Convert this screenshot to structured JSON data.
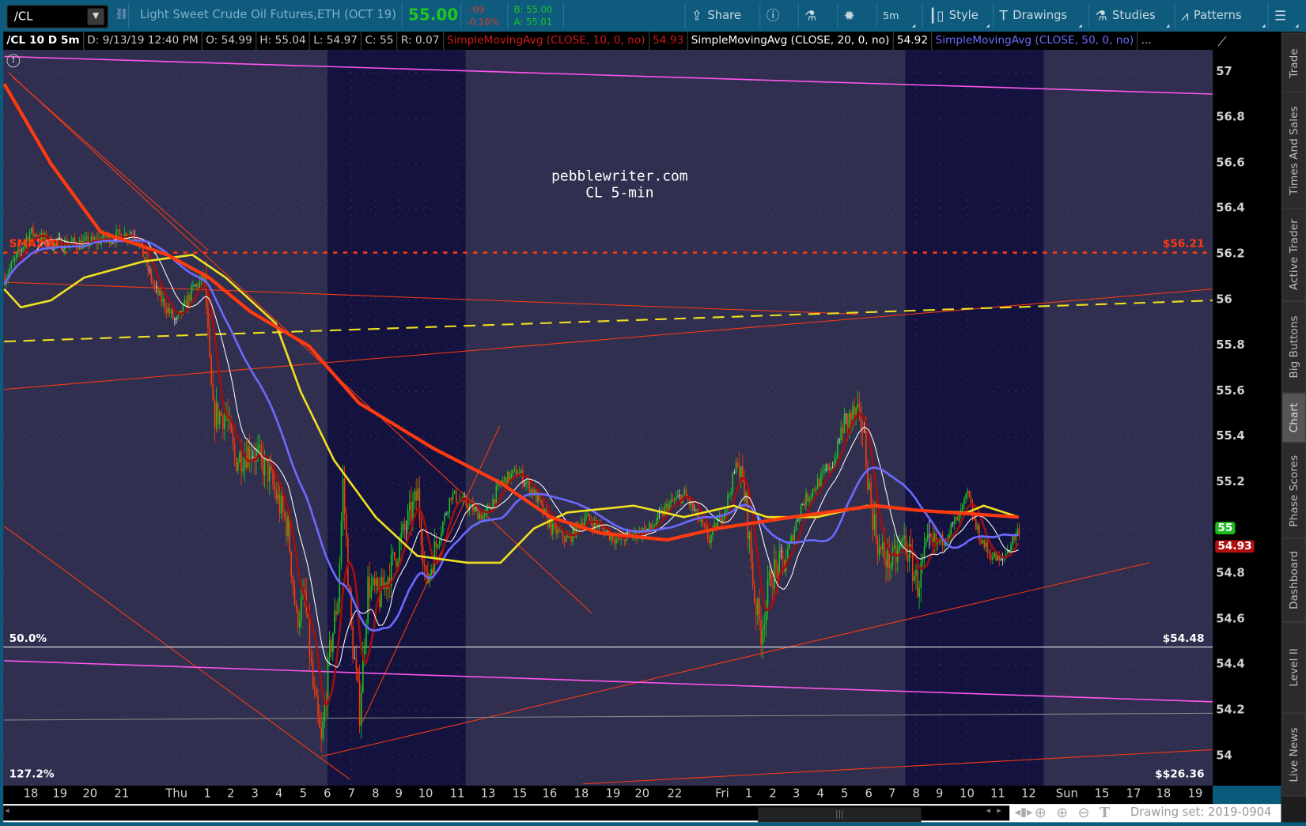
{
  "toolbar": {
    "symbol": "/CL",
    "description": "Light Sweet Crude Oil Futures,ETH (OCT 19)",
    "last": "55.00",
    "net_change": "-.09",
    "pct_change": "-0.16%",
    "bid": "B: 55.00",
    "ask": "A: 55.01",
    "buttons": [
      {
        "label": "Share",
        "icon": "share-icon"
      },
      {
        "label": "",
        "icon": "info-icon"
      },
      {
        "label": "",
        "icon": "flask-icon"
      },
      {
        "label": "",
        "icon": "gear-icon"
      },
      {
        "label": "5m",
        "icon": ""
      },
      {
        "label": "Style",
        "icon": "candlestick-icon"
      },
      {
        "label": "Drawings",
        "icon": "text-t-icon"
      },
      {
        "label": "Studies",
        "icon": "flask-icon"
      },
      {
        "label": "Patterns",
        "icon": "patterns-icon"
      },
      {
        "label": "",
        "icon": "menu-icon"
      }
    ]
  },
  "infobar": {
    "title": "/CL 10 D 5m",
    "date": "D: 9/13/19 12:40 PM",
    "open": "O: 54.99",
    "high": "H: 55.04",
    "low": "L: 54.97",
    "close": "C: 55",
    "range": "R: 0.07",
    "study1": "SimpleMovingAvg (CLOSE, 10, 0, no)",
    "study1_value": "54.93",
    "study2": "SimpleMovingAvg (CLOSE, 20, 0, no)",
    "study2_value": "54.92",
    "study3": "SimpleMovingAvg (CLOSE, 50, 0, no)",
    "more": "..."
  },
  "right_tabs": [
    "Trade",
    "Times And Sales",
    "Active Trader",
    "Big Buttons",
    "Chart",
    "Phase Scores",
    "Dashboard",
    "Level II",
    "Live News"
  ],
  "active_tab": "Chart",
  "bottom": {
    "drawing_set": "Drawing set: 2019-0904"
  },
  "chart_data": {
    "type": "candlestick",
    "watermark": [
      "pebblewriter.com",
      "CL 5-min"
    ],
    "ylim": [
      53.9,
      57.1
    ],
    "y_ticks": [
      "57",
      "56.8",
      "56.6",
      "56.4",
      "56.2",
      "56",
      "55.8",
      "55.6",
      "55.4",
      "55.2",
      "55",
      "54.8",
      "54.6",
      "54.4",
      "54.2",
      "54"
    ],
    "x_ticks": [
      "18",
      "19",
      "20",
      "21",
      "Thu",
      "1",
      "2",
      "3",
      "4",
      "5",
      "6",
      "7",
      "8",
      "9",
      "10",
      "11",
      "13",
      "15",
      "16",
      "18",
      "19",
      "20",
      "22",
      "Fri",
      "1",
      "2",
      "3",
      "4",
      "5",
      "6",
      "7",
      "8",
      "9",
      "10",
      "11",
      "12",
      "Sun",
      "15",
      "17",
      "18",
      "19"
    ],
    "bars": 610,
    "close_waypoints": [
      [
        0,
        56.1
      ],
      [
        8,
        56.2
      ],
      [
        15,
        56.3
      ],
      [
        28,
        56.25
      ],
      [
        48,
        56.25
      ],
      [
        78,
        56.3
      ],
      [
        83,
        56.2
      ],
      [
        90,
        56.05
      ],
      [
        103,
        55.9
      ],
      [
        113,
        56.05
      ],
      [
        120,
        56.1
      ],
      [
        123,
        55.7
      ],
      [
        125,
        55.5
      ],
      [
        133,
        55.5
      ],
      [
        138,
        55.3
      ],
      [
        148,
        55.35
      ],
      [
        158,
        55.25
      ],
      [
        165,
        55.1
      ],
      [
        170,
        55.0
      ],
      [
        175,
        54.6
      ],
      [
        180,
        54.7
      ],
      [
        185,
        54.3
      ],
      [
        190,
        54.05
      ],
      [
        195,
        54.45
      ],
      [
        200,
        54.7
      ],
      [
        203,
        55.2
      ],
      [
        208,
        54.55
      ],
      [
        213,
        54.2
      ],
      [
        218,
        54.75
      ],
      [
        225,
        54.7
      ],
      [
        233,
        54.85
      ],
      [
        243,
        55.05
      ],
      [
        248,
        55.15
      ],
      [
        253,
        54.75
      ],
      [
        258,
        54.9
      ],
      [
        268,
        55.15
      ],
      [
        278,
        55.1
      ],
      [
        288,
        55.05
      ],
      [
        298,
        55.2
      ],
      [
        308,
        55.25
      ],
      [
        318,
        55.15
      ],
      [
        328,
        55.0
      ],
      [
        338,
        54.95
      ],
      [
        348,
        55.05
      ],
      [
        358,
        55.0
      ],
      [
        368,
        54.95
      ],
      [
        388,
        55.0
      ],
      [
        398,
        55.1
      ],
      [
        408,
        55.15
      ],
      [
        423,
        54.95
      ],
      [
        433,
        55.1
      ],
      [
        440,
        55.3
      ],
      [
        445,
        55.1
      ],
      [
        450,
        54.7
      ],
      [
        454,
        54.55
      ],
      [
        460,
        54.8
      ],
      [
        468,
        54.85
      ],
      [
        478,
        55.1
      ],
      [
        488,
        55.2
      ],
      [
        498,
        55.3
      ],
      [
        503,
        55.45
      ],
      [
        510,
        55.5
      ],
      [
        515,
        55.45
      ],
      [
        520,
        55.1
      ],
      [
        525,
        54.9
      ],
      [
        533,
        54.85
      ],
      [
        540,
        54.95
      ],
      [
        548,
        54.75
      ],
      [
        553,
        54.9
      ],
      [
        563,
        54.95
      ],
      [
        573,
        55.05
      ],
      [
        578,
        55.15
      ],
      [
        583,
        55.0
      ],
      [
        590,
        54.9
      ],
      [
        598,
        54.85
      ],
      [
        605,
        54.95
      ],
      [
        609,
        55.0
      ]
    ],
    "series": [
      {
        "name": "SimpleMovingAvg (CLOSE, 10, 0, no)",
        "period": 10,
        "color": "#a00f0f"
      },
      {
        "name": "SimpleMovingAvg (CLOSE, 20, 0, no)",
        "period": 20,
        "color": "#ffffff"
      },
      {
        "name": "SimpleMovingAvg (CLOSE, 50, 0, no)",
        "period": 50,
        "color": "#6a6aff"
      },
      {
        "name": "",
        "color": "#f0e020",
        "waypoints": [
          [
            0,
            56.05
          ],
          [
            10,
            55.97
          ],
          [
            28,
            56.0
          ],
          [
            48,
            56.1
          ],
          [
            83,
            56.17
          ],
          [
            113,
            56.2
          ],
          [
            133,
            56.1
          ],
          [
            163,
            55.9
          ],
          [
            178,
            55.6
          ],
          [
            198,
            55.3
          ],
          [
            223,
            55.05
          ],
          [
            248,
            54.88
          ],
          [
            278,
            54.85
          ],
          [
            298,
            54.85
          ],
          [
            318,
            55.0
          ],
          [
            338,
            55.07
          ],
          [
            378,
            55.1
          ],
          [
            408,
            55.05
          ],
          [
            438,
            55.1
          ],
          [
            458,
            55.05
          ],
          [
            488,
            55.05
          ],
          [
            518,
            55.1
          ],
          [
            548,
            55.08
          ],
          [
            578,
            55.07
          ],
          [
            588,
            55.1
          ],
          [
            609,
            55.05
          ]
        ]
      },
      {
        "name": "SMA200",
        "color": "#ff3a10",
        "waypoints": [
          [
            0,
            56.95
          ],
          [
            28,
            56.6
          ],
          [
            58,
            56.3
          ],
          [
            98,
            56.2
          ],
          [
            123,
            56.1
          ],
          [
            148,
            55.95
          ],
          [
            183,
            55.8
          ],
          [
            213,
            55.55
          ],
          [
            258,
            55.35
          ],
          [
            298,
            55.2
          ],
          [
            328,
            55.05
          ],
          [
            358,
            54.98
          ],
          [
            398,
            54.95
          ],
          [
            428,
            55.0
          ],
          [
            473,
            55.05
          ],
          [
            523,
            55.1
          ],
          [
            548,
            55.08
          ],
          [
            609,
            55.05
          ]
        ]
      }
    ],
    "sessions_highlighted": [
      [
        194,
        277
      ],
      [
        541,
        624
      ]
    ],
    "drawings": [
      {
        "kind": "trendline",
        "color": "#ff55ee",
        "points": [
          [
            0,
            57.07
          ],
          [
            725.5,
            56.905
          ]
        ]
      },
      {
        "kind": "horizontal",
        "color": "#ff3a10",
        "style": "dotted",
        "price": 56.21,
        "label_left": "SMA200",
        "label_right": "$56.21"
      },
      {
        "kind": "trendline",
        "color": "#ff3a10",
        "points": [
          [
            2.5,
            57.0
          ],
          [
            352.5,
            54.63
          ]
        ]
      },
      {
        "kind": "trendline",
        "color": "#ff3a10",
        "points": [
          [
            5,
            56.98
          ],
          [
            122.5,
            56.22
          ]
        ]
      },
      {
        "kind": "trendline",
        "color": "#ff3a10",
        "points": [
          [
            0,
            56.08
          ],
          [
            512.5,
            55.94
          ]
        ]
      },
      {
        "kind": "trendline",
        "color": "#ff3a10",
        "points": [
          [
            0,
            55.61
          ],
          [
            725.5,
            56.05
          ]
        ]
      },
      {
        "kind": "trendline",
        "color": "#f0e020",
        "style": "dashed",
        "points": [
          [
            0,
            55.82
          ],
          [
            725.5,
            56.0
          ]
        ]
      },
      {
        "kind": "trendline",
        "color": "#ff3a10",
        "points": [
          [
            0,
            55.01
          ],
          [
            207.5,
            53.9
          ]
        ]
      },
      {
        "kind": "trendline",
        "color": "#ff3a10",
        "points": [
          [
            190,
            54.0
          ],
          [
            687.5,
            54.85
          ]
        ]
      },
      {
        "kind": "trendline",
        "color": "#ff3a10",
        "points": [
          [
            215,
            54.15
          ],
          [
            297.5,
            55.45
          ]
        ]
      },
      {
        "kind": "horizontal",
        "color": "#ffffff",
        "price": 54.48,
        "label_left": "50.0%",
        "label_right": "$54.48"
      },
      {
        "kind": "trendline",
        "color": "#ff55ee",
        "points": [
          [
            0,
            54.42
          ],
          [
            725.5,
            54.24
          ]
        ]
      },
      {
        "kind": "trendline",
        "color": "#888888",
        "points": [
          [
            0,
            54.16
          ],
          [
            725.5,
            54.19
          ]
        ]
      },
      {
        "kind": "trendline",
        "color": "#ff3a10",
        "points": [
          [
            347.5,
            53.88
          ],
          [
            725.5,
            54.03
          ]
        ],
        "label_left": "127.2%",
        "label_right": "$$26.36"
      }
    ],
    "price_badges": [
      {
        "text": "55",
        "color": "#1fb81f",
        "price": 55.0
      },
      {
        "text": "54.93",
        "color": "#b01010",
        "price": 54.93
      }
    ],
    "colors": {
      "up": "#19c819",
      "down": "#ff3a00",
      "background": "#302f4f",
      "session": "#14133f"
    }
  }
}
